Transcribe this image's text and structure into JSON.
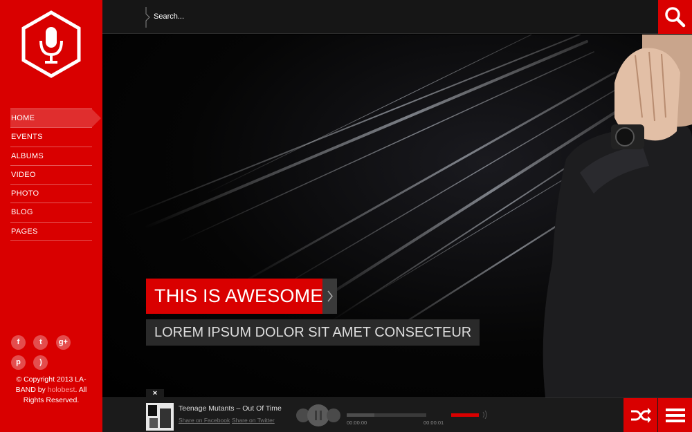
{
  "sidebar": {
    "nav": [
      {
        "label": "HOME",
        "active": true
      },
      {
        "label": "EVENTS",
        "active": false
      },
      {
        "label": "ALBUMS",
        "active": false
      },
      {
        "label": "VIDEO",
        "active": false
      },
      {
        "label": "PHOTO",
        "active": false
      },
      {
        "label": "BLOG",
        "active": false
      },
      {
        "label": "PAGES",
        "active": false
      }
    ],
    "social": [
      {
        "icon": "facebook-icon",
        "glyph": "f"
      },
      {
        "icon": "twitter-icon",
        "glyph": "t"
      },
      {
        "icon": "google-plus-icon",
        "glyph": "g+"
      },
      {
        "icon": "pinterest-icon",
        "glyph": "p"
      },
      {
        "icon": "rss-icon",
        "glyph": ")"
      }
    ],
    "copyright_prefix": "© Copyright 2013 LA-BAND by",
    "copyright_author": "holobest",
    "copyright_suffix": ". All Rights Reserved."
  },
  "search": {
    "placeholder": "Search..."
  },
  "hero": {
    "title": "THIS IS AWESOME",
    "subtitle": "LOREM IPSUM DOLOR SIT AMET CONSECTEUR"
  },
  "player": {
    "close": "×",
    "track_title": "Teenage Mutants – Out Of Time",
    "share_facebook": "Share on Facebook",
    "share_twitter": "Share on Twitter",
    "time_current": "00:00:00",
    "time_total": "00:00:01",
    "progress": 0.35,
    "volume": 1.0
  },
  "colors": {
    "accent": "#d90000",
    "bar": "#161616"
  }
}
